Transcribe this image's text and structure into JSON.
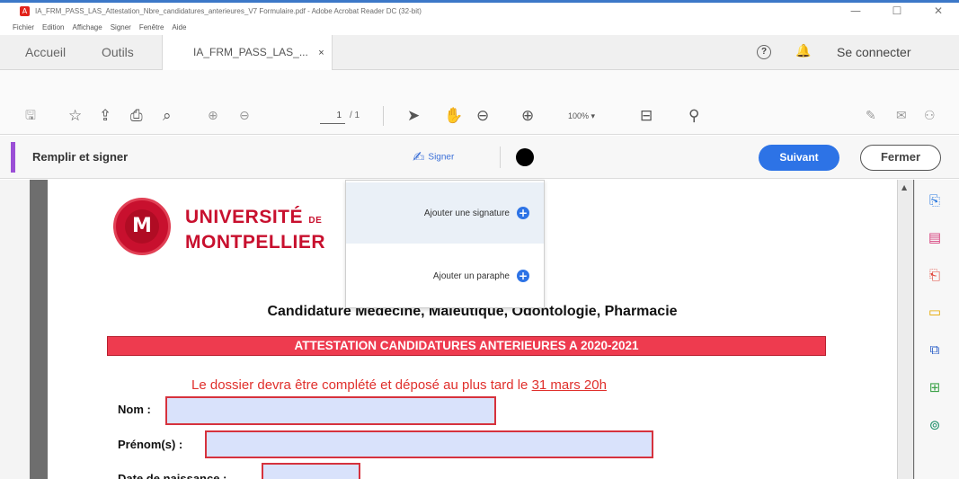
{
  "window": {
    "title": "IA_FRM_PASS_LAS_Attestation_Nbre_candidatures_anterieures_V7 Formulaire.pdf - Adobe Acrobat Reader DC (32-bit)",
    "controls": {
      "minimize": "—",
      "maximize": "☐",
      "close": "✕"
    }
  },
  "menubar": [
    "Fichier",
    "Edition",
    "Affichage",
    "Signer",
    "Fenêtre",
    "Aide"
  ],
  "tabs": {
    "home": "Accueil",
    "tools": "Outils",
    "document": "IA_FRM_PASS_LAS_...",
    "close": "×",
    "connect": "Se connecter"
  },
  "toolbar": {
    "page_current": "1",
    "page_total": "/ 1",
    "zoom": "100%"
  },
  "fillsign": {
    "label": "Remplir et signer",
    "sign": "Signer",
    "next": "Suivant",
    "close": "Fermer",
    "ink_color": "#000000"
  },
  "dropdown": {
    "add_signature": "Ajouter une signature",
    "add_initials": "Ajouter un paraphe"
  },
  "document": {
    "logo_line1": "UNIVERSITÉ",
    "logo_de": "DE",
    "logo_line2": "MONTPELLIER",
    "heading": "Candidature Médecine, Maïeutique, Odontologie, Pharmacie",
    "banner": "ATTESTATION CANDIDATURES ANTERIEURES A 2020-2021",
    "deadline_text": "Le dossier devra être complété et déposé au plus tard le",
    "deadline_date": "31 mars 20h",
    "fields": {
      "nom_label": "Nom :",
      "prenom_label": "Prénom(s) :",
      "dob_label": "Date de naissance :"
    }
  },
  "colors": {
    "accent_blue": "#2d73e6",
    "brand_red": "#c8102e",
    "banner_red": "#ee3b4f",
    "field_fill": "#d9e2fb",
    "fillsign_accent": "#9b4fd6"
  }
}
